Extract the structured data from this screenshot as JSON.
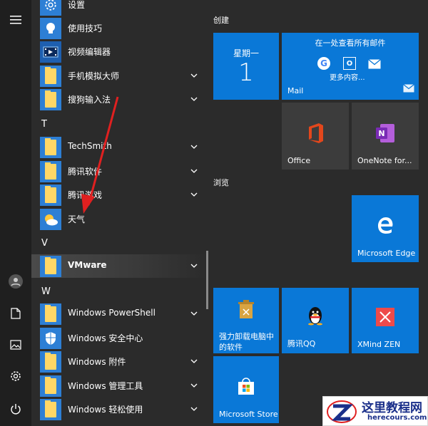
{
  "app_list": {
    "rows": [
      {
        "label": "设置"
      },
      {
        "label": "使用技巧"
      },
      {
        "label": "视频编辑器"
      },
      {
        "label": "手机模拟大师"
      },
      {
        "label": "搜狗输入法"
      },
      {
        "label": "TechSmith"
      },
      {
        "label": "腾讯软件"
      },
      {
        "label": "腾讯游戏"
      },
      {
        "label": "天气"
      },
      {
        "label": "VMware"
      },
      {
        "label": "Windows PowerShell"
      },
      {
        "label": "Windows 安全中心"
      },
      {
        "label": "Windows 附件"
      },
      {
        "label": "Windows 管理工具"
      },
      {
        "label": "Windows 轻松使用"
      }
    ],
    "letters": [
      "T",
      "V",
      "W"
    ],
    "selected": "VMware"
  },
  "tiles": {
    "groups": [
      "创建",
      "浏览"
    ],
    "calendar": {
      "day": "星期一",
      "date": "1"
    },
    "mail": {
      "headline": "在一处查看所有邮件",
      "more": "更多内容...",
      "name": "Mail"
    },
    "office": {
      "name": "Office"
    },
    "onenote": {
      "name": "OneNote for..."
    },
    "edge": {
      "name": "Microsoft Edge"
    },
    "uninstall": {
      "name_line1": "强力卸载电脑中",
      "name_line2": "的软件"
    },
    "qq": {
      "name": "腾讯QQ"
    },
    "xmind": {
      "name": "XMind ZEN"
    },
    "store": {
      "name": "Microsoft Store"
    }
  },
  "watermark": {
    "title": "这里教程网",
    "url": "herecours.com"
  },
  "colors": {
    "tile_blue": "#0a78d7",
    "folder_blue": "#2d7fd5",
    "arrow_red": "#e02020"
  }
}
